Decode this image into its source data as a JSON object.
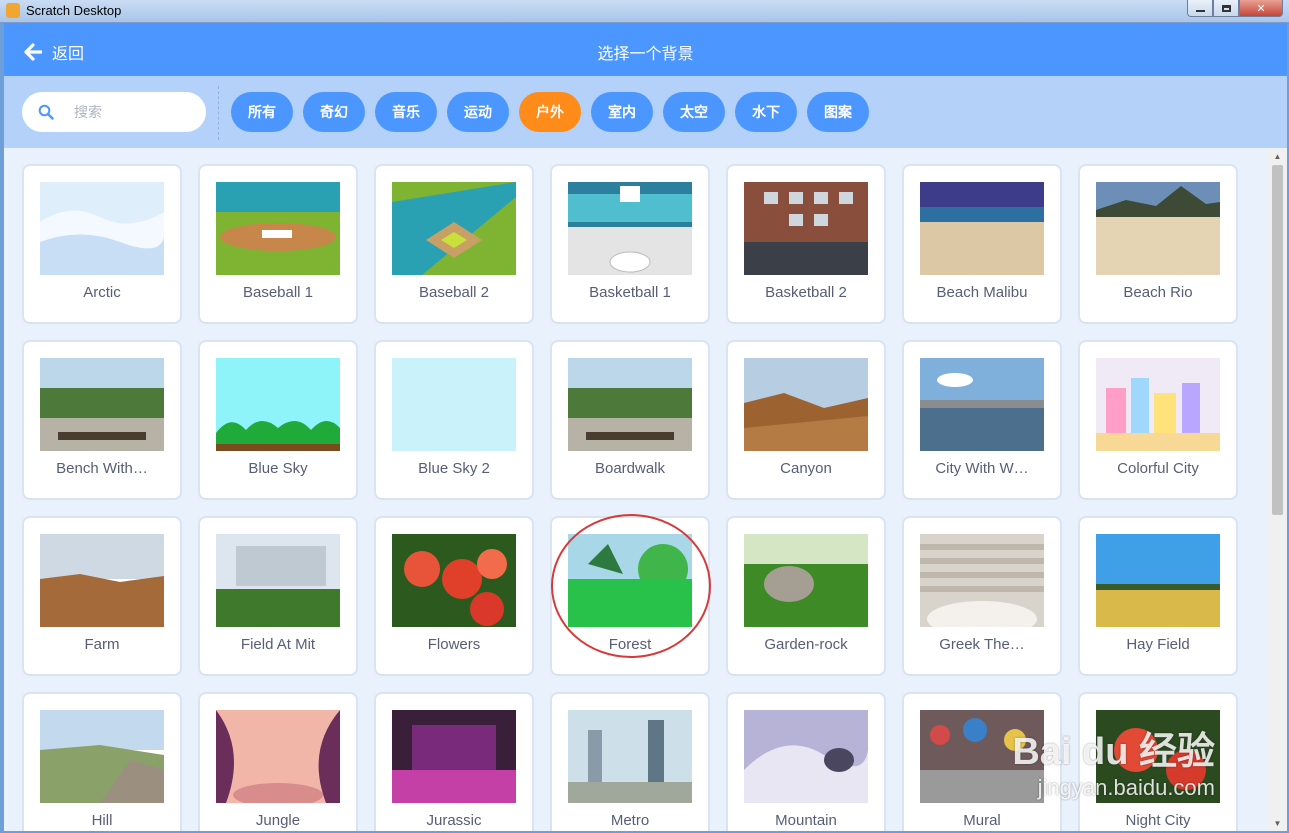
{
  "window": {
    "title": "Scratch Desktop"
  },
  "header": {
    "back_label": "返回",
    "title": "选择一个背景"
  },
  "search": {
    "placeholder": "搜索",
    "value": ""
  },
  "tags": [
    {
      "label": "所有",
      "active": false
    },
    {
      "label": "奇幻",
      "active": false
    },
    {
      "label": "音乐",
      "active": false
    },
    {
      "label": "运动",
      "active": false
    },
    {
      "label": "户外",
      "active": true
    },
    {
      "label": "室内",
      "active": false
    },
    {
      "label": "太空",
      "active": false
    },
    {
      "label": "水下",
      "active": false
    },
    {
      "label": "图案",
      "active": false
    }
  ],
  "backdrops": [
    "Arctic",
    "Baseball 1",
    "Baseball 2",
    "Basketball 1",
    "Basketball 2",
    "Beach Malibu",
    "Beach Rio",
    "Bench With…",
    "Blue Sky",
    "Blue Sky 2",
    "Boardwalk",
    "Canyon",
    "City With W…",
    "Colorful City",
    "Farm",
    "Field At Mit",
    "Flowers",
    "Forest",
    "Garden-rock",
    "Greek The…",
    "Hay Field",
    "Hill",
    "Jungle",
    "Jurassic",
    "Metro",
    "Mountain",
    "Mural",
    "Night City"
  ],
  "highlighted": "Forest",
  "colors": {
    "header": "#4c97ff",
    "tag": "#4c97ff",
    "tag_active": "#ff8c1a",
    "filter_bar": "#b4d2f9"
  },
  "watermark": {
    "brand": "Bai du 经验",
    "url": "jingyan.baidu.com"
  }
}
